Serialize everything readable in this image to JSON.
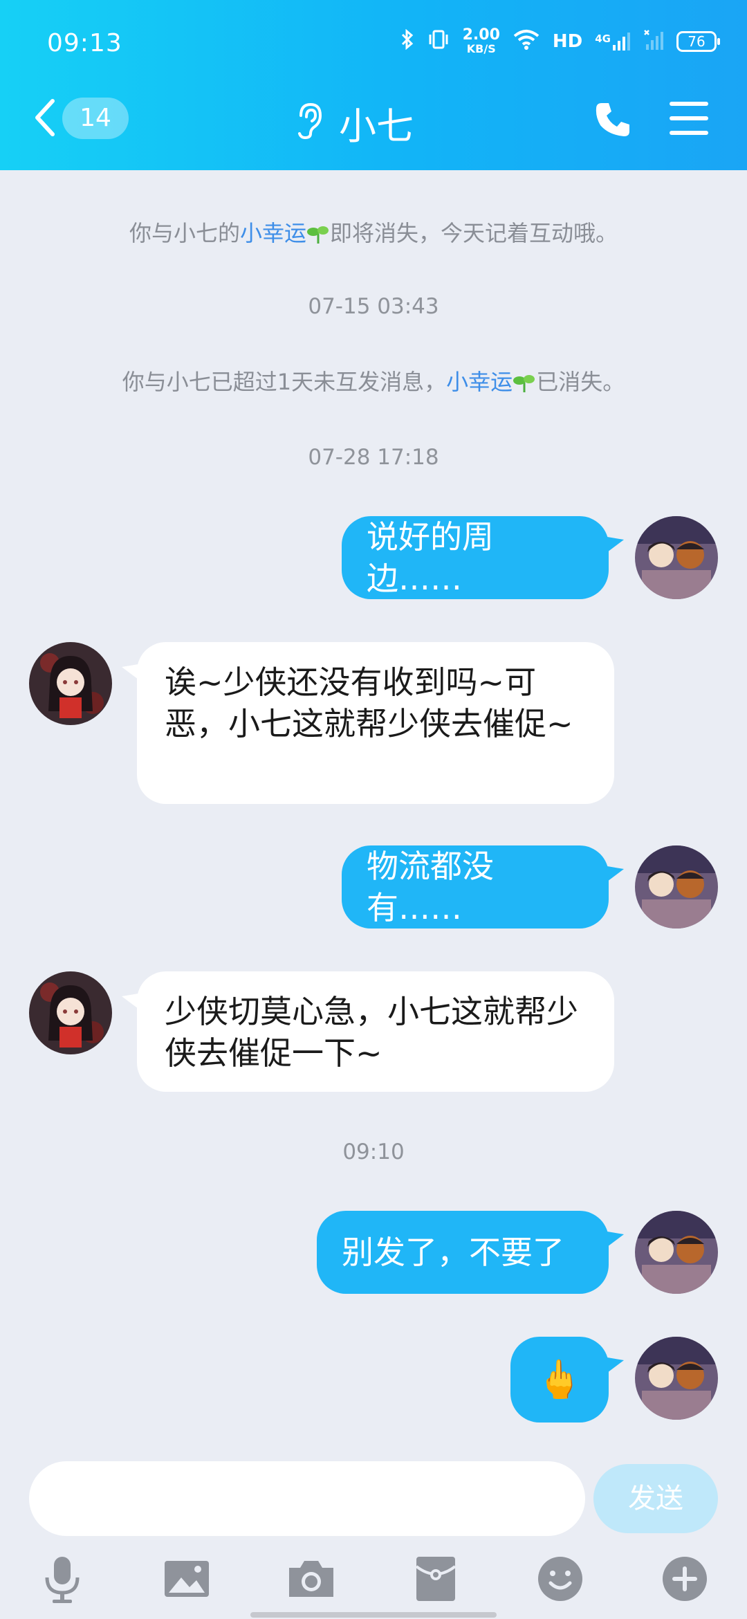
{
  "status_bar": {
    "time": "09:13",
    "net_speed_value": "2.00",
    "net_speed_unit": "KB/S",
    "hd_label": "HD",
    "signal_label": "4G",
    "battery": "76"
  },
  "header": {
    "unread_count": "14",
    "title": "小七"
  },
  "messages": {
    "sys1_prefix": "你与小七的",
    "sys1_link": "小幸运",
    "sys1_suffix": "即将消失，今天记着互动哦。",
    "ts1": "07-15 03:43",
    "sys2_prefix": "你与小七已超过1天未互发消息，",
    "sys2_link": "小幸运",
    "sys2_suffix": "已消失。",
    "ts2": "07-28 17:18",
    "m1": "说好的周边……",
    "m2": "诶~少侠还没有收到吗~可恶，小七这就帮少侠去催促~",
    "m3": "物流都没有……",
    "m4": "少侠切莫心急，小七这就帮少侠去催促一下~",
    "ts3": "09:10",
    "m5": "别发了，不要了",
    "m6": "🖕"
  },
  "input": {
    "placeholder": "",
    "send_label": "发送"
  },
  "toolbar": {
    "icons": [
      "microphone-icon",
      "image-icon",
      "camera-icon",
      "red-packet-icon",
      "emoji-icon",
      "plus-icon"
    ]
  },
  "colors": {
    "header_start": "#16d0f6",
    "header_end": "#1aa5f5",
    "my_bubble": "#20b6f7",
    "link": "#3e8ee8",
    "background": "#eaedf4"
  }
}
